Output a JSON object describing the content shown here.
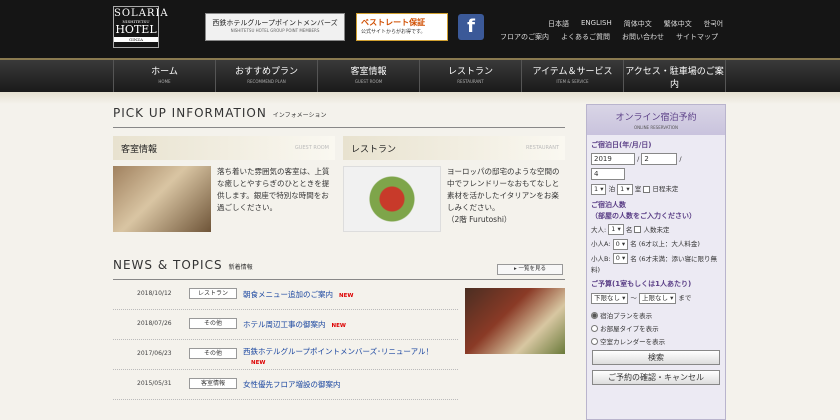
{
  "logo": {
    "l1": "SOLARIA",
    "l2": "NISHITETSU",
    "l3": "HOTEL",
    "l4": "GINZA"
  },
  "banner1": {
    "title": "西鉄ホテルグループポイントメンバーズ",
    "sub": "NISHITETSU HOTEL GROUP POINT MEMBERS"
  },
  "banner2": {
    "title": "ベストレート保証",
    "sub": "公式サイトからがお得です。"
  },
  "facebook": "f",
  "languages": [
    "日本語",
    "ENGLISH",
    "简体中文",
    "繁体中文",
    "한국어"
  ],
  "toplinks": [
    "フロアのご案内",
    "よくあるご質問",
    "お問い合わせ",
    "サイトマップ"
  ],
  "nav": [
    {
      "label": "ホーム",
      "sub": "HOME"
    },
    {
      "label": "おすすめプラン",
      "sub": "RECOMMEND PLAN"
    },
    {
      "label": "客室情報",
      "sub": "GUEST ROOM"
    },
    {
      "label": "レストラン",
      "sub": "RESTAURANT"
    },
    {
      "label": "アイテム＆サービス",
      "sub": "ITEM & SERVICE"
    },
    {
      "label": "アクセス・駐車場のご案内",
      "sub": "ACCESS・PARKING"
    }
  ],
  "pickup": {
    "title": "PICK UP INFORMATION",
    "sub": "インフォメーション",
    "cards": [
      {
        "title": "客室情報",
        "en": "GUEST ROOM",
        "text": "落ち着いた雰囲気の客室は、上質な癒しとやすらぎのひとときを提供します。銀座で特別な時間をお過ごしください。"
      },
      {
        "title": "レストラン",
        "en": "RESTAURANT",
        "text": "ヨーロッパの邸宅のような空間の中でフレンドリーなおもてなしと素材を活かしたイタリアンをお楽しみください。",
        "note": "（2階 Furutoshi）"
      }
    ]
  },
  "news": {
    "title": "NEWS & TOPICS",
    "sub": "新着情報",
    "more": "一覧を見る",
    "items": [
      {
        "date": "2018/10/12",
        "cat": "レストラン",
        "title": "朝食メニュー追加のご案内",
        "new": "NEW"
      },
      {
        "date": "2018/07/26",
        "cat": "その他",
        "title": "ホテル周辺工事の御案内",
        "new": "NEW"
      },
      {
        "date": "2017/06/23",
        "cat": "その他",
        "title": "西鉄ホテルグループポイントメンバーズ･リニューアル！",
        "new": "NEW"
      },
      {
        "date": "2015/05/31",
        "cat": "客室情報",
        "title": "女性優先フロア増設の御案内",
        "new": ""
      }
    ]
  },
  "reserve": {
    "title": "オンライン宿泊予約",
    "sub": "ONLINE RESERVATION",
    "checkin_label": "ご宿泊日(年/月/日)",
    "year": "2019",
    "month": "2",
    "day": "4",
    "nights": "1",
    "nights_unit": "泊",
    "rooms": "1",
    "rooms_unit": "室",
    "undecided": "日程未定",
    "people_label": "ご宿泊人数",
    "people_sub": "（部屋の人数をご入力ください）",
    "adult_label": "大人:",
    "adult": "1",
    "adult_unit": "名",
    "people_undecided": "人数未定",
    "childA_label": "小人A:",
    "childA": "0",
    "childA_note": "名 (6才以上：大人料金)",
    "childB_label": "小人B:",
    "childB": "0",
    "childB_note": "名 (6才未満：添い寝に限り無料)",
    "budget_label": "ご予算(1室もしくは1人あたり)",
    "budget_min": "下限なし",
    "budget_sep": "〜",
    "budget_max": "上限なし",
    "budget_unit": "まで",
    "options": [
      "宿泊プランを表示",
      "お部屋タイプを表示",
      "空室カレンダーを表示"
    ],
    "search": "検索",
    "confirm": "ご予約の確認・キャンセル"
  }
}
